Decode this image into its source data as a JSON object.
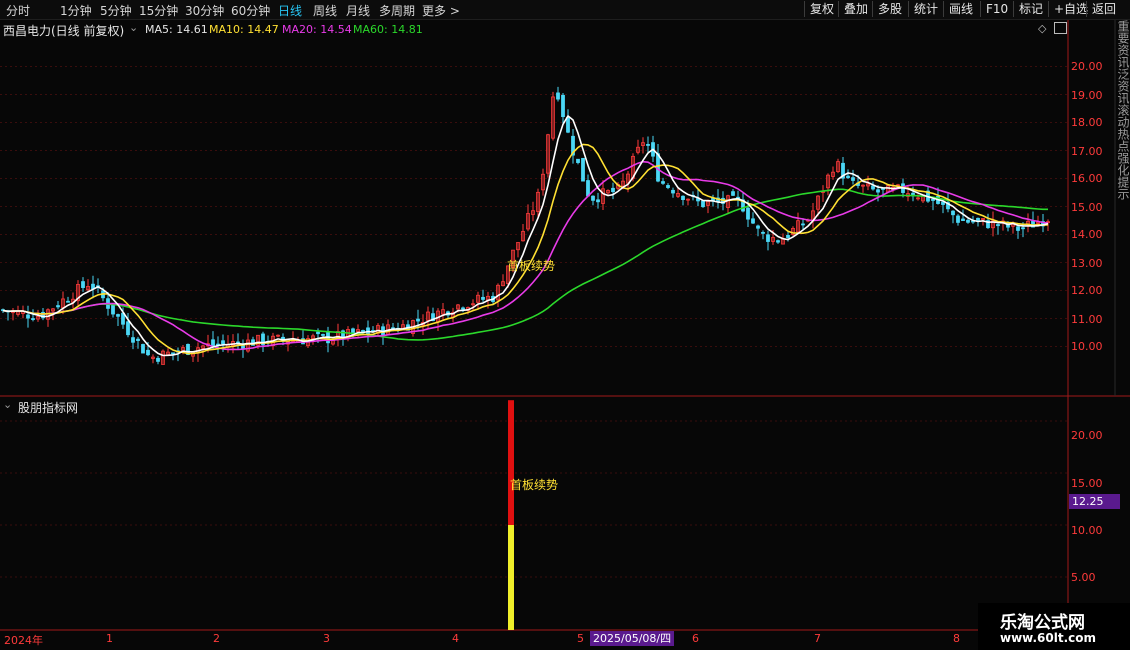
{
  "toolbar": {
    "periods": [
      "分时",
      "1分钟",
      "5分钟",
      "15分钟",
      "30分钟",
      "60分钟",
      "日线",
      "周线",
      "月线",
      "多周期",
      "更多 >"
    ],
    "active_period": "日线",
    "right_buttons": [
      "复权",
      "叠加",
      "多股",
      "统计",
      "画线",
      "F10",
      "标记",
      "+自选",
      "返回"
    ]
  },
  "chart_header": {
    "title": "西昌电力(日线 前复权)",
    "ma5": "MA5: 14.61",
    "ma10": "MA10: 14.47",
    "ma20": "MA20: 14.54",
    "ma60": "MA60: 14.81"
  },
  "price_axis_labels": [
    "20.00",
    "19.00",
    "18.00",
    "17.00",
    "16.00",
    "15.00",
    "14.00",
    "13.00",
    "12.00",
    "11.00",
    "10.00"
  ],
  "side_vertical_text": "重要资讯泛资讯滚动热点强化提示",
  "annotation_main": "首板续势",
  "indicator_panel": {
    "title": "股朋指标网",
    "axis_labels": [
      "20.00",
      "15.00",
      "10.00",
      "5.00"
    ],
    "current_value": "12.25",
    "bar_label": "首板续势"
  },
  "x_axis": {
    "labels": [
      "2024年",
      "1",
      "2",
      "3",
      "4",
      "5",
      "6",
      "7",
      "8"
    ],
    "cursor_date": "2025/05/08/四"
  },
  "watermark": {
    "line1": "乐淘公式网",
    "line2": "www.60lt.com"
  },
  "colors": {
    "ma5": "#ffffff",
    "ma10": "#ffe033",
    "ma20": "#e83be8",
    "ma60": "#2bd82b",
    "up": "#ff3b3b",
    "down": "#4ad7f5",
    "active": "#27c6f5"
  },
  "chart_data": {
    "type": "candlestick",
    "price_axis": [
      9.5,
      21.0
    ],
    "indicator_axis": [
      3,
      22
    ],
    "indicator_bar": {
      "value": 22,
      "lower_segment_value": 10,
      "label": "首板续势"
    },
    "ma_last": {
      "ma5": 14.61,
      "ma10": 14.47,
      "ma20": 14.54,
      "ma60": 14.81
    }
  }
}
